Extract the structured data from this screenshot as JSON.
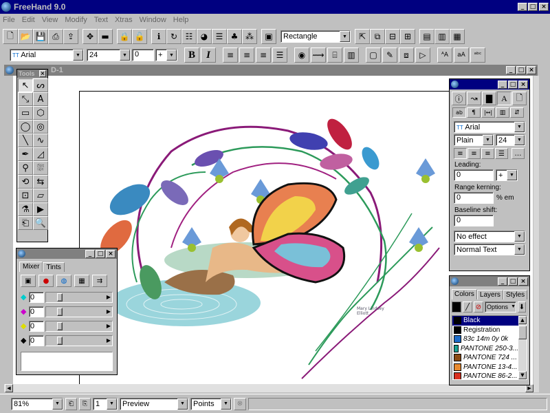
{
  "app": {
    "title": "FreeHand 9.0"
  },
  "menu": [
    "File",
    "Edit",
    "View",
    "Modify",
    "Text",
    "Xtras",
    "Window",
    "Help"
  ],
  "toolbar": {
    "shape_select": "Rectangle"
  },
  "textbar": {
    "font": "Arial",
    "size": "24",
    "tracking": "0",
    "tracking_unit": "+",
    "bold": "B",
    "italic": "I"
  },
  "doc": {
    "title": "D-1"
  },
  "tools_panel": {
    "title": "Tools"
  },
  "text_inspector": {
    "font": "Arial",
    "style": "Plain",
    "size": "24",
    "leading_label": "Leading:",
    "leading_value": "0",
    "leading_unit": "+",
    "range_kerning_label": "Range kerning:",
    "range_kerning_value": "0",
    "range_kerning_unit": "% em",
    "baseline_label": "Baseline shift:",
    "baseline_value": "0",
    "effect": "No effect",
    "text_style": "Normal Text"
  },
  "mixer_panel": {
    "tabs": [
      "Mixer",
      "Tints"
    ],
    "values": [
      "0",
      "0",
      "0",
      "0"
    ]
  },
  "colors_panel": {
    "tabs": [
      "Colors",
      "Layers",
      "Styles"
    ],
    "options_label": "Options",
    "items": [
      {
        "name": "Black",
        "color": "#000000"
      },
      {
        "name": "Registration",
        "color": "#000000"
      },
      {
        "name": "83c 14m 0y 0k",
        "color": "#1e6cc8"
      },
      {
        "name": "PANTONE 250-3...",
        "color": "#1aa090"
      },
      {
        "name": "PANTONE 724 ...",
        "color": "#8a4a14"
      },
      {
        "name": "PANTONE 13-4...",
        "color": "#e88a30"
      },
      {
        "name": "PANTONE 86-2...",
        "color": "#d83020"
      }
    ]
  },
  "artwork": {
    "signature_line1": "Mary Lindsey",
    "signature_line2": "Elliott"
  },
  "statusbar": {
    "zoom": "81%",
    "page": "1",
    "view_mode": "Preview",
    "units": "Points"
  }
}
